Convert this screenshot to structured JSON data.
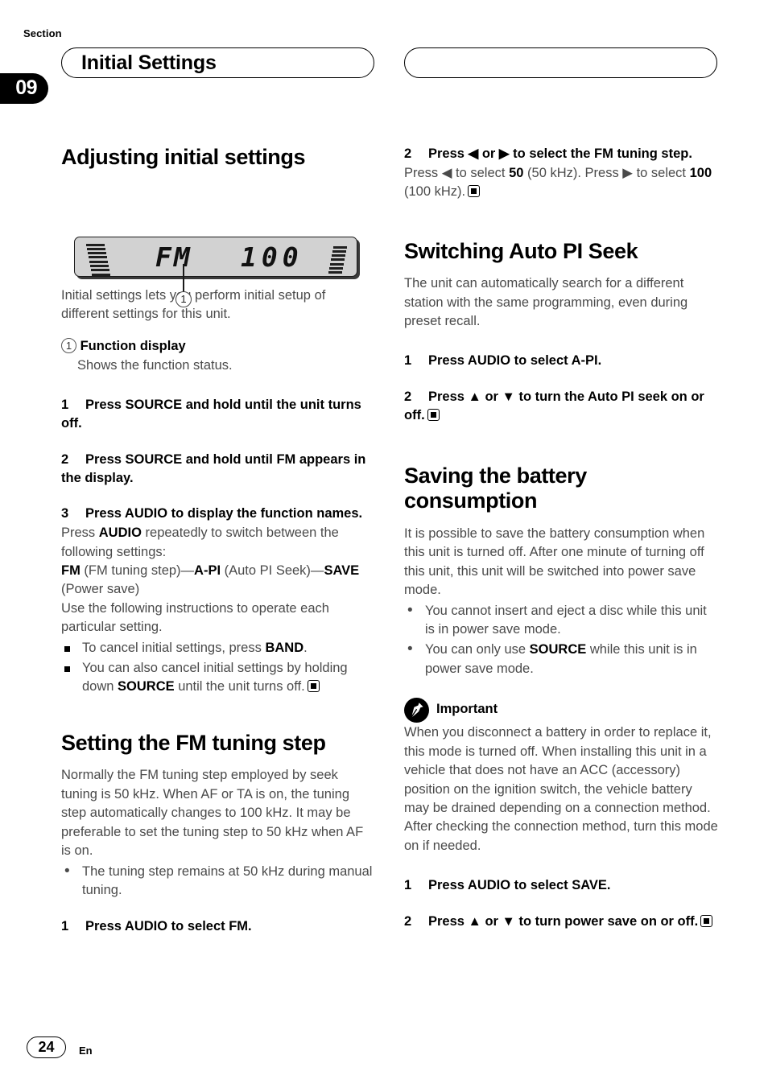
{
  "header": {
    "section_label": "Section",
    "section_number": "09",
    "title": "Initial Settings"
  },
  "figure": {
    "lcd_mode": "FM",
    "lcd_value": "100",
    "callout_number": "1"
  },
  "left_column": {
    "heading": "Adjusting initial settings",
    "intro": "Initial settings lets you perform initial setup of different settings for this unit.",
    "callout": {
      "marker": "1",
      "term": "Function display",
      "description": "Shows the function status."
    },
    "step1": {
      "num": "1",
      "text": "Press SOURCE and hold until the unit turns off."
    },
    "step2": {
      "num": "2",
      "text": "Press SOURCE and hold until FM appears in the display."
    },
    "step3": {
      "num": "3",
      "text": "Press AUDIO to display the function names."
    },
    "step3_body_1a": "Press ",
    "step3_body_1b": "AUDIO",
    "step3_body_1c": " repeatedly to switch between the following settings:",
    "step3_settings": {
      "fm": "FM",
      "fm_desc": " (FM tuning step)—",
      "api": "A-PI",
      "api_desc": " (Auto PI Seek)—",
      "save": "SAVE",
      "save_desc": " (Power save)"
    },
    "step3_body_2": "Use the following instructions to operate each particular setting.",
    "bullet1a": "To cancel initial settings, press ",
    "bullet1b": "BAND",
    "bullet1c": ".",
    "bullet2a": "You can also cancel initial settings by holding down ",
    "bullet2b": "SOURCE",
    "bullet2c": " until the unit turns off.",
    "heading2": "Setting the FM tuning step",
    "fm_intro": "Normally the FM tuning step employed by seek tuning is 50 kHz. When AF or TA is on, the tuning step automatically changes to 100 kHz. It may be preferable to set the tuning step to 50 kHz when AF is on.",
    "fm_bullet": "The tuning step remains at 50 kHz during manual tuning.",
    "fm_step1": {
      "num": "1",
      "text": "Press AUDIO to select FM."
    }
  },
  "right_column": {
    "fm_step2": {
      "num": "2",
      "text": "Press ◀ or ▶ to select the FM tuning step."
    },
    "fm_step2_body": {
      "p1": "Press ◀ to select ",
      "v1": "50",
      "p2": " (50 kHz). Press ▶ to select ",
      "v2": "100",
      "p3": " (100 kHz)."
    },
    "heading_api": "Switching Auto PI Seek",
    "api_intro": "The unit can automatically search for a different station with the same programming, even during preset recall.",
    "api_step1": {
      "num": "1",
      "text": "Press AUDIO to select A-PI."
    },
    "api_step2": {
      "num": "2",
      "text": "Press ▲ or ▼ to turn the Auto PI seek on or off."
    },
    "heading_battery": "Saving the battery consumption",
    "battery_intro": "It is possible to save the battery consumption when this unit is turned off. After one minute of turning off this unit, this unit will be switched into power save mode.",
    "battery_bullet1": "You cannot insert and eject a disc while this unit is in power save mode.",
    "battery_bullet2a": "You can only use ",
    "battery_bullet2b": "SOURCE",
    "battery_bullet2c": " while this unit is in power save mode.",
    "important_label": "Important",
    "important_text": "When you disconnect a battery in order to replace it, this mode is turned off. When installing this unit in a vehicle that does not have an ACC (accessory) position on the ignition switch, the vehicle battery may be drained depending on a connection method. After checking the connection method, turn this mode on if needed.",
    "save_step1": {
      "num": "1",
      "text": "Press AUDIO to select SAVE."
    },
    "save_step2": {
      "num": "2",
      "text": "Press ▲ or ▼ to turn power save on or off."
    }
  },
  "footer": {
    "page_number": "24",
    "language": "En"
  }
}
